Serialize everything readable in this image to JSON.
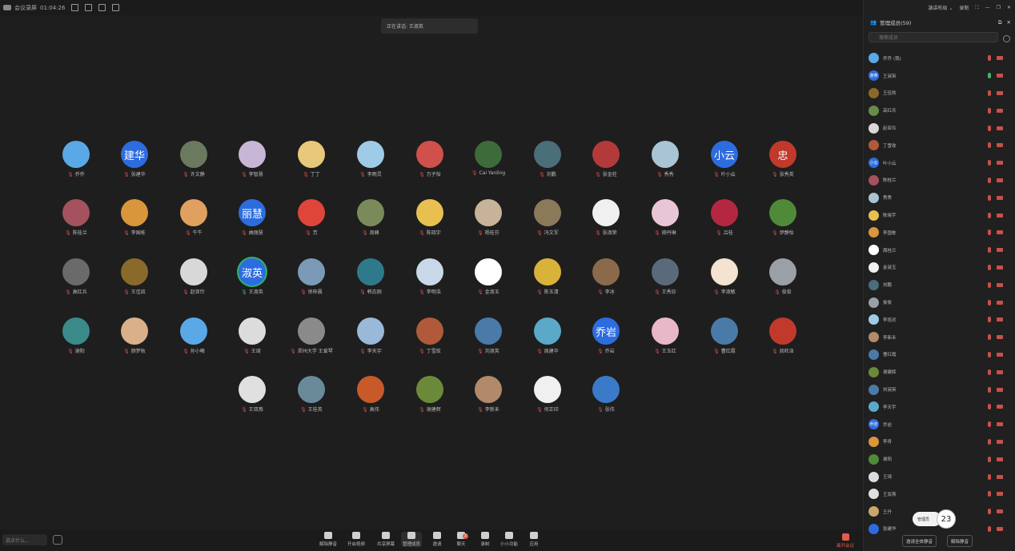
{
  "topbar": {
    "app_name": "会议录屏",
    "elapsed": "01:04:26",
    "right_items": [
      "演讲布局",
      "录制"
    ],
    "layout_label": "演讲布局 ⌄",
    "record_label": "录制"
  },
  "speaking_banner": "正在讲话: 王淑英",
  "participants": [
    {
      "name": "乔乔",
      "mic": "off",
      "color": "#5aa9e6",
      "label": ""
    },
    {
      "name": "张建华",
      "mic": "off",
      "color": "#2d6cdf",
      "label": "建华"
    },
    {
      "name": "许文静",
      "mic": "off",
      "color": "#6b7a5e",
      "label": ""
    },
    {
      "name": "李智慧",
      "mic": "off",
      "color": "#c9b6d6",
      "label": ""
    },
    {
      "name": "丁丁",
      "mic": "off",
      "color": "#e8c87a",
      "label": ""
    },
    {
      "name": "李雨灵",
      "mic": "off",
      "color": "#9ecbe6",
      "label": ""
    },
    {
      "name": "万子怡",
      "mic": "off",
      "color": "#d0504a",
      "label": ""
    },
    {
      "name": "Cai Yanling",
      "mic": "off",
      "color": "#3e6b3a",
      "label": ""
    },
    {
      "name": "刘鹏",
      "mic": "off",
      "color": "#4a6e7a",
      "label": ""
    },
    {
      "name": "张金柱",
      "mic": "off",
      "color": "#b33a3a",
      "label": ""
    },
    {
      "name": "秀秀",
      "mic": "off",
      "color": "#a9c4d4",
      "label": ""
    },
    {
      "name": "叶小云",
      "mic": "off",
      "color": "#2d6cdf",
      "label": "小云"
    },
    {
      "name": "张秀英",
      "mic": "off",
      "color": "#c0392b",
      "label": "忠"
    },
    {
      "name": "陈桂兰",
      "mic": "off",
      "color": "#a3525e",
      "label": ""
    },
    {
      "name": "李国栋",
      "mic": "off",
      "color": "#d9963a",
      "label": ""
    },
    {
      "name": "牛牛",
      "mic": "off",
      "color": "#e0a060",
      "label": ""
    },
    {
      "name": "曲丽慧",
      "mic": "off",
      "color": "#2d6cdf",
      "label": "丽慧"
    },
    {
      "name": "芳",
      "mic": "off",
      "color": "#e0453a",
      "label": ""
    },
    {
      "name": "周峰",
      "mic": "off",
      "color": "#7a8a5a",
      "label": ""
    },
    {
      "name": "陈晓宇",
      "mic": "off",
      "color": "#e8c050",
      "label": ""
    },
    {
      "name": "杨桂芬",
      "mic": "off",
      "color": "#c7b39a",
      "label": ""
    },
    {
      "name": "冯文军",
      "mic": "off",
      "color": "#8a7a5a",
      "label": ""
    },
    {
      "name": "张淑荣",
      "mic": "off",
      "color": "#f0f0f0",
      "label": ""
    },
    {
      "name": "柳丹琳",
      "mic": "off",
      "color": "#e9c6d6",
      "label": ""
    },
    {
      "name": "吕桂",
      "mic": "off",
      "color": "#b32840",
      "label": ""
    },
    {
      "name": "伊静怡",
      "mic": "off",
      "color": "#4e8a3a",
      "label": ""
    },
    {
      "name": "高红兵",
      "mic": "off",
      "color": "#6a6a6a",
      "label": ""
    },
    {
      "name": "王佳凯",
      "mic": "off",
      "color": "#8a6a2a",
      "label": ""
    },
    {
      "name": "赵亚玲",
      "mic": "off",
      "color": "#d8d8d8",
      "label": ""
    },
    {
      "name": "王淑英",
      "mic": "on",
      "color": "#2d6cdf",
      "label": "淑英",
      "speaking": true
    },
    {
      "name": "徐梓晨",
      "mic": "off",
      "color": "#7a9ab8",
      "label": ""
    },
    {
      "name": "韩志刚",
      "mic": "off",
      "color": "#2e7a8a",
      "label": ""
    },
    {
      "name": "李明浩",
      "mic": "off",
      "color": "#c8d8e8",
      "label": ""
    },
    {
      "name": "金淑玉",
      "mic": "off",
      "color": "#ffffff",
      "label": ""
    },
    {
      "name": "陈玉清",
      "mic": "off",
      "color": "#d9b23a",
      "label": ""
    },
    {
      "name": "李冰",
      "mic": "off",
      "color": "#8a6a4a",
      "label": ""
    },
    {
      "name": "王秀珍",
      "mic": "off",
      "color": "#5a6a7a",
      "label": ""
    },
    {
      "name": "李淑敏",
      "mic": "off",
      "color": "#f3e3d0",
      "label": ""
    },
    {
      "name": "俊俊",
      "mic": "off",
      "color": "#9aa0a6",
      "label": ""
    },
    {
      "name": "谢阳",
      "mic": "off",
      "color": "#3a8a8a",
      "label": ""
    },
    {
      "name": "颜梦秋",
      "mic": "off",
      "color": "#d9b08a",
      "label": ""
    },
    {
      "name": "孙小曦",
      "mic": "off",
      "color": "#5aa9e6",
      "label": ""
    },
    {
      "name": "王琦",
      "mic": "off",
      "color": "#dcdcdc",
      "label": ""
    },
    {
      "name": "郑州大学 王爱琴",
      "mic": "off",
      "color": "#8a8a8a",
      "label": ""
    },
    {
      "name": "李天宇",
      "mic": "off",
      "color": "#9ab8d8",
      "label": ""
    },
    {
      "name": "丁雪玫",
      "mic": "off",
      "color": "#b05a3a",
      "label": ""
    },
    {
      "name": "刘淑英",
      "mic": "off",
      "color": "#4a7aa8",
      "label": ""
    },
    {
      "name": "周建华",
      "mic": "off",
      "color": "#5aa9c8",
      "label": ""
    },
    {
      "name": "乔岩",
      "mic": "off",
      "color": "#2d6cdf",
      "label": "乔岩"
    },
    {
      "name": "王玉红",
      "mic": "off",
      "color": "#e8b8c8",
      "label": ""
    },
    {
      "name": "曹红霞",
      "mic": "off",
      "color": "#4a7aa8",
      "label": ""
    },
    {
      "name": "凯旺泽",
      "mic": "off",
      "color": "#c0392b",
      "label": ""
    },
    {
      "name": "王双燕",
      "mic": "off",
      "color": "#e0e0e0",
      "label": ""
    },
    {
      "name": "王桂英",
      "mic": "off",
      "color": "#6a8a9a",
      "label": ""
    },
    {
      "name": "高伟",
      "mic": "off",
      "color": "#c85a2a",
      "label": ""
    },
    {
      "name": "谢建辉",
      "mic": "off",
      "color": "#6a8a3a",
      "label": ""
    },
    {
      "name": "李新禾",
      "mic": "off",
      "color": "#b08a6a",
      "label": ""
    },
    {
      "name": "何正印",
      "mic": "off",
      "color": "#f0f0f0",
      "label": ""
    },
    {
      "name": "张伟",
      "mic": "off",
      "color": "#3a7ac8",
      "label": ""
    }
  ],
  "toolbar": {
    "say_placeholder": "说点什么...",
    "buttons": [
      "解除静音",
      "开启视频",
      "共享屏幕",
      "管理成员",
      "邀请",
      "聊天",
      "录制",
      "小小功能",
      "应用"
    ],
    "chat_badge": "2",
    "leave_label": "离开会议"
  },
  "panel": {
    "header_bar": [
      "⊞",
      "设置",
      "⬚",
      "◧",
      "—",
      "⧠",
      "✕"
    ],
    "title": "管理成员(59)",
    "search_placeholder": "搜索成员",
    "members": [
      {
        "name": "乔乔",
        "sub": "(我)",
        "color": "#5aa9e6",
        "label": "",
        "mic": "off"
      },
      {
        "name": "王淑英",
        "color": "#2d6cdf",
        "label": "淑英",
        "mic": "on"
      },
      {
        "name": "王佳凯",
        "color": "#8a6a2a",
        "label": "",
        "mic": "off"
      },
      {
        "name": "高红兵",
        "color": "#6a8a4a",
        "label": "",
        "mic": "off"
      },
      {
        "name": "赵亚玲",
        "color": "#d8d8d8",
        "label": "",
        "mic": "off"
      },
      {
        "name": "丁雪玫",
        "color": "#b05a3a",
        "label": "",
        "mic": "off"
      },
      {
        "name": "叶小云",
        "color": "#2d6cdf",
        "label": "小云",
        "mic": "off"
      },
      {
        "name": "陈桂兰",
        "color": "#a3525e",
        "label": "",
        "mic": "off"
      },
      {
        "name": "秀秀",
        "color": "#a9c4d4",
        "label": "",
        "mic": "off"
      },
      {
        "name": "陈晓宇",
        "color": "#e8c050",
        "label": "",
        "mic": "off"
      },
      {
        "name": "李国栋",
        "color": "#d9963a",
        "label": "",
        "mic": "off"
      },
      {
        "name": "周桂兰",
        "color": "#ffffff",
        "label": "",
        "mic": "off"
      },
      {
        "name": "金淑玉",
        "color": "#f0f0f0",
        "label": "",
        "mic": "off"
      },
      {
        "name": "刘鹏",
        "color": "#4a6e7a",
        "label": "",
        "mic": "off"
      },
      {
        "name": "俊俊",
        "color": "#9aa0a6",
        "label": "",
        "mic": "off"
      },
      {
        "name": "李雨灵",
        "color": "#9ecbe6",
        "label": "",
        "mic": "off"
      },
      {
        "name": "李新禾",
        "color": "#b08a6a",
        "label": "",
        "mic": "off"
      },
      {
        "name": "曹红霞",
        "color": "#4a7aa8",
        "label": "",
        "mic": "off"
      },
      {
        "name": "谢建辉",
        "color": "#6a8a3a",
        "label": "",
        "mic": "off"
      },
      {
        "name": "刘淑英",
        "color": "#4a7aa8",
        "label": "",
        "mic": "off"
      },
      {
        "name": "李天宇",
        "color": "#5aa9c8",
        "label": "",
        "mic": "off"
      },
      {
        "name": "乔岩",
        "color": "#2d6cdf",
        "label": "乔岩",
        "mic": "off"
      },
      {
        "name": "李青",
        "color": "#d9963a",
        "label": "",
        "mic": "off"
      },
      {
        "name": "谢阳",
        "color": "#4e8a3a",
        "label": "",
        "mic": "off"
      },
      {
        "name": "王琦",
        "color": "#dcdcdc",
        "label": "",
        "mic": "off"
      },
      {
        "name": "王双燕",
        "color": "#e0e0e0",
        "label": "",
        "mic": "off"
      },
      {
        "name": "王丹",
        "color": "#c8a86a",
        "label": "",
        "mic": "off"
      },
      {
        "name": "张建华",
        "color": "#2d6cdf",
        "label": "",
        "mic": "off"
      }
    ],
    "footer_buttons": [
      "邀请全体静音",
      "解除静音"
    ],
    "bubble_text": "管理员",
    "count_badge": "23"
  }
}
